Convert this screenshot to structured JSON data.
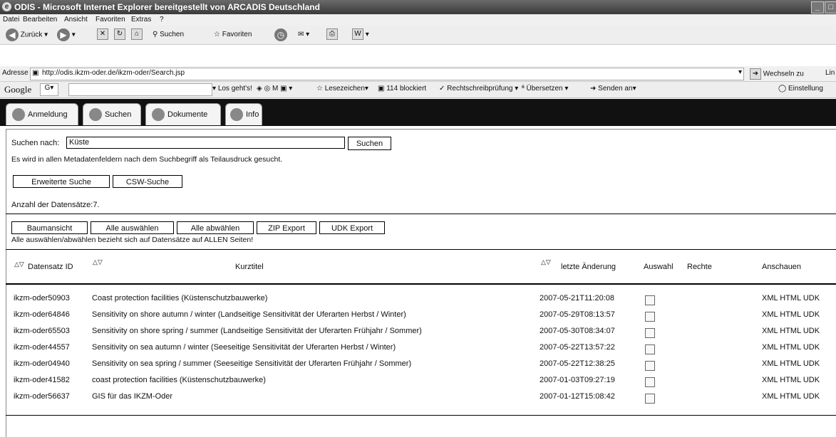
{
  "window": {
    "title": "ODIS - Microsoft Internet Explorer bereitgestellt von ARCADIS Deutschland"
  },
  "menu": [
    "Datei",
    "Bearbeiten",
    "Ansicht",
    "Favoriten",
    "Extras",
    "?"
  ],
  "toolbar": {
    "back": "Zurück",
    "search": "Suchen",
    "favorites": "Favoriten"
  },
  "address": {
    "label": "Adresse",
    "url": "http://odis.ikzm-oder.de/ikzm-oder/Search.jsp",
    "go": "Wechseln zu",
    "links": "Lin"
  },
  "google": {
    "logo": "Google",
    "box": "G",
    "go": "Los geht's!",
    "bookmarks": "Lesezeichen",
    "blocked": "114 blockiert",
    "spell": "Rechtschreibprüfung",
    "translate": "Übersetzen",
    "send": "Senden an",
    "settings": "Einstellung"
  },
  "tabs": [
    "Anmeldung",
    "Suchen",
    "Dokumente",
    "Info"
  ],
  "search": {
    "label": "Suchen nach:",
    "value": "Küste",
    "button": "Suchen",
    "hint": "Es wird in allen Metadatenfeldern nach dem Suchbegriff als Teilausdruck gesucht.",
    "advanced": "Erweiterte Suche",
    "csw": "CSW-Suche",
    "count": "Anzahl der Datensätze:7."
  },
  "actions": {
    "tree": "Baumansicht",
    "select_all": "Alle auswählen",
    "deselect_all": "Alle abwählen",
    "zip": "ZIP Export",
    "udk": "UDK Export",
    "note": "Alle auswählen/abwählen bezieht sich auf Datensätze auf ALLEN Seiten!"
  },
  "table": {
    "sort_arrows": "△▽",
    "headers": {
      "id": "Datensatz ID",
      "title": "Kurztitel",
      "changed": "letzte Änderung",
      "select": "Auswahl",
      "rights": "Rechte",
      "view": "Anschauen"
    },
    "rows": [
      {
        "id": "ikzm-oder50903",
        "title": "Coast protection facilities (Küstenschutzbauwerke)",
        "changed": "2007-05-21T11:20:08",
        "view": "XML HTML UDK"
      },
      {
        "id": "ikzm-oder64846",
        "title": "Sensitivity on shore autumn / winter (Landseitige Sensitivität der Uferarten Herbst / Winter)",
        "changed": "2007-05-29T08:13:57",
        "view": "XML HTML UDK"
      },
      {
        "id": "ikzm-oder65503",
        "title": "Sensitivity on shore spring / summer (Landseitige Sensitivität der Uferarten Frühjahr / Sommer)",
        "changed": "2007-05-30T08:34:07",
        "view": "XML HTML UDK"
      },
      {
        "id": "ikzm-oder44557",
        "title": "Sensitivity on sea autumn / winter (Seeseitige Sensitivität der Uferarten Herbst / Winter)",
        "changed": "2007-05-22T13:57:22",
        "view": "XML HTML UDK"
      },
      {
        "id": "ikzm-oder04940",
        "title": "Sensitivity on sea spring / summer (Seeseitige Sensitivität der Uferarten Frühjahr / Sommer)",
        "changed": "2007-05-22T12:38:25",
        "view": "XML HTML UDK"
      },
      {
        "id": "ikzm-oder41582",
        "title": "coast protection facilities (Küstenschutzbauwerke)",
        "changed": "2007-01-03T09:27:19",
        "view": "XML HTML UDK"
      },
      {
        "id": "ikzm-oder56637",
        "title": "GIS für das IKZM-Oder",
        "changed": "2007-01-12T15:08:42",
        "view": "XML HTML UDK"
      }
    ]
  }
}
